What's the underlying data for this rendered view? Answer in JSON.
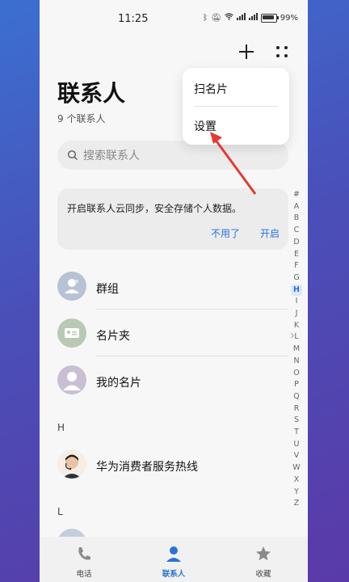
{
  "status": {
    "time": "11:25",
    "battery": "99%"
  },
  "header": {
    "title": "联系人",
    "count": "9 个联系人"
  },
  "search": {
    "placeholder": "搜索联系人"
  },
  "sync_card": {
    "message": "开启联系人云同步，安全存储个人数据。",
    "dismiss": "不用了",
    "enable": "开启"
  },
  "list": {
    "groups": "群组",
    "card_holder": "名片夹",
    "my_card": "我的名片",
    "section_h": "H",
    "huawei": "华为消费者服务热线",
    "section_l": "L"
  },
  "alphabet": [
    "#",
    "A",
    "B",
    "C",
    "D",
    "E",
    "F",
    "G",
    "H",
    "I",
    "J",
    "K",
    "L",
    "M",
    "N",
    "O",
    "P",
    "Q",
    "R",
    "S",
    "T",
    "U",
    "V",
    "W",
    "X",
    "Y",
    "Z"
  ],
  "alphabet_active": "H",
  "popup": {
    "scan_card": "扫名片",
    "settings": "设置"
  },
  "bottom_nav": {
    "phone": "电话",
    "contacts": "联系人",
    "favorites": "收藏"
  },
  "colors": {
    "accent": "#2a72d6",
    "annotation_arrow": "#e53935"
  }
}
